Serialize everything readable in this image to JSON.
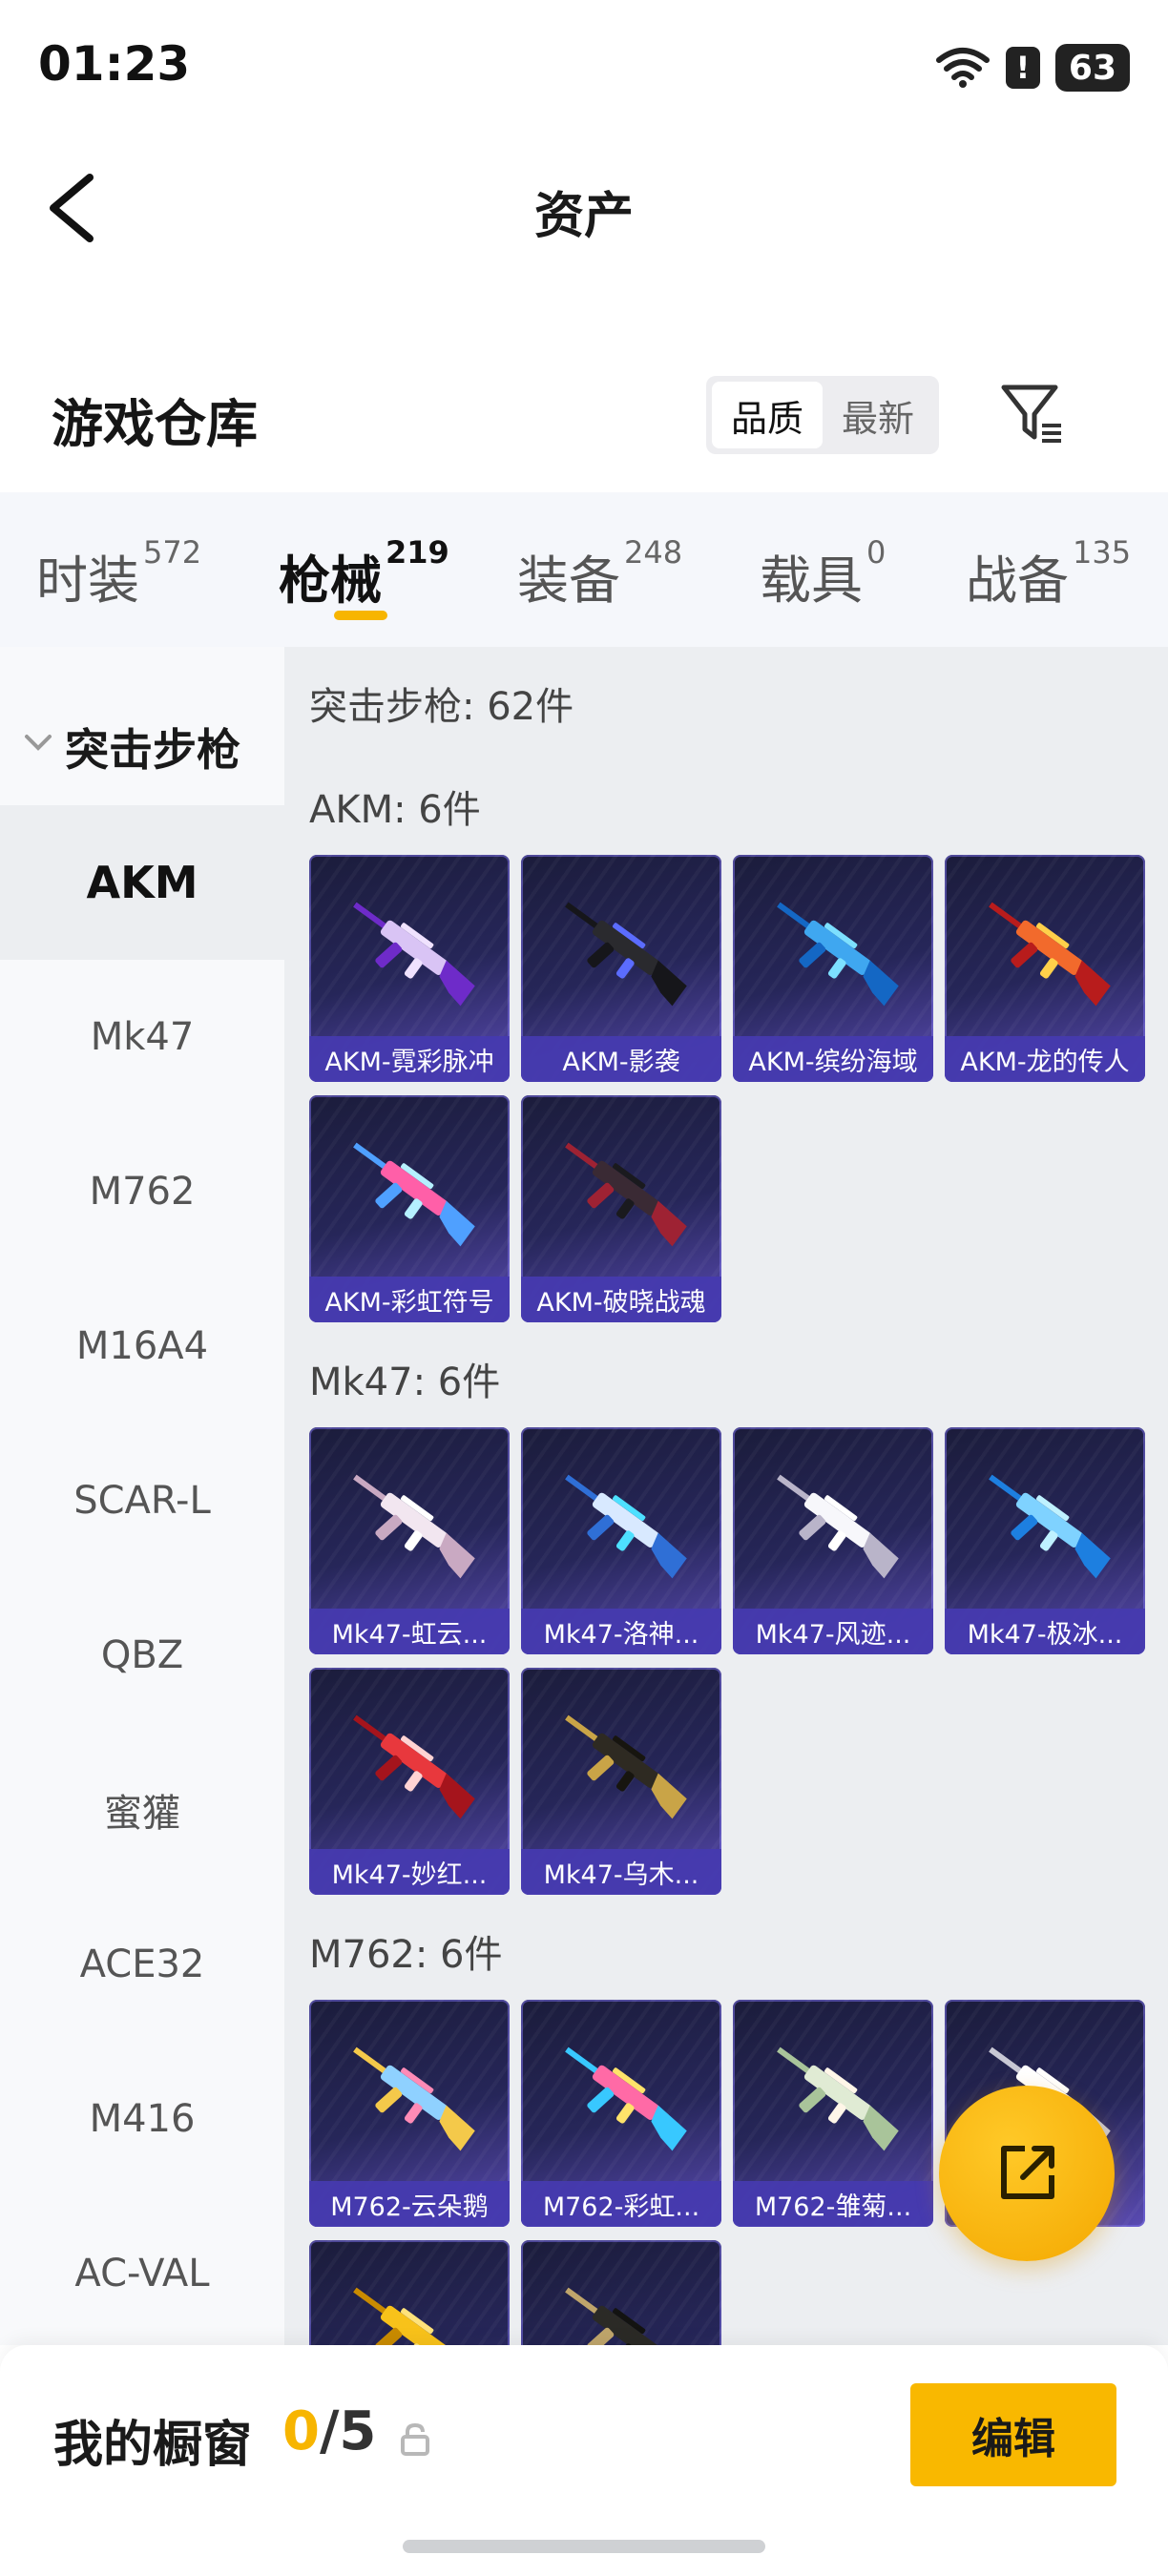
{
  "status": {
    "time": "01:23",
    "battery": "63",
    "alert": "!"
  },
  "header": {
    "title": "资产"
  },
  "warehouse": {
    "title": "游戏仓库",
    "sort_options": [
      "品质",
      "最新"
    ],
    "active_sort": "品质"
  },
  "category_tabs": [
    {
      "label": "时装",
      "count": "572"
    },
    {
      "label": "枪械",
      "count": "219"
    },
    {
      "label": "装备",
      "count": "248"
    },
    {
      "label": "载具",
      "count": "0"
    },
    {
      "label": "战备",
      "count": "135"
    }
  ],
  "active_tab": "枪械",
  "sidebar": {
    "group_label": "突击步枪",
    "items": [
      "AKM",
      "Mk47",
      "M762",
      "M16A4",
      "SCAR-L",
      "QBZ",
      "蜜獾",
      "ACE32",
      "M416",
      "AC-VAL"
    ],
    "active_item": "AKM"
  },
  "content": {
    "total": "突击步枪: 62件",
    "groups": [
      {
        "heading": "AKM: 6件",
        "items": [
          "AKM-霓彩脉冲",
          "AKM-影袭",
          "AKM-缤纷海域",
          "AKM-龙的传人",
          "AKM-彩虹符号",
          "AKM-破晓战魂"
        ]
      },
      {
        "heading": "Mk47: 6件",
        "items": [
          "Mk47-虹云...",
          "Mk47-洛神...",
          "Mk47-风迹...",
          "Mk47-极冰...",
          "Mk47-妙红...",
          "Mk47-乌木..."
        ]
      },
      {
        "heading": "M762: 6件",
        "items": [
          "M762-云朵鹅",
          "M762-彩虹...",
          "M762-雏菊...",
          "",
          "",
          ""
        ]
      }
    ]
  },
  "gun_colors": [
    [
      "#d9c4f5",
      "#6e2bc9",
      "#f0e2ff"
    ],
    [
      "#2a2a2e",
      "#16161a",
      "#5b6cff"
    ],
    [
      "#3fa7f0",
      "#1467c4",
      "#7de0ff"
    ],
    [
      "#f26a2c",
      "#b81c1c",
      "#ffd04a"
    ],
    [
      "#ff5fa8",
      "#4fa0ff",
      "#b5f0ff"
    ],
    [
      "#3a2a34",
      "#9e2233",
      "#1a1a1e"
    ],
    [
      "#f2e6f0",
      "#c9a9c2",
      "#ffffff"
    ],
    [
      "#d8e9ff",
      "#2f6fd6",
      "#4de0ff"
    ],
    [
      "#f7f7fb",
      "#b9b4c9",
      "#ffffff"
    ],
    [
      "#7fd2ff",
      "#1d7fe0",
      "#bff1ff"
    ],
    [
      "#e8383d",
      "#a5141c",
      "#ffd3d3"
    ],
    [
      "#2e2a22",
      "#c9a447",
      "#17150f"
    ],
    [
      "#8fd1ff",
      "#f4c94a",
      "#ff8bb6"
    ],
    [
      "#ff6aa6",
      "#38c8ff",
      "#ffe36a"
    ],
    [
      "#e0ebd4",
      "#a9c49a",
      "#fff6e8"
    ],
    [
      "#ffffff",
      "#c8c8d4",
      "#ffffff"
    ],
    [
      "#f8c21a",
      "#c98b00",
      "#ffe27a"
    ],
    [
      "#2b2a26",
      "#bfa56b",
      "#131311"
    ]
  ],
  "showcase": {
    "title": "我的橱窗",
    "current": "0",
    "slash": "/",
    "max": "5"
  },
  "edit_label": "编辑",
  "icons": {
    "back": "back-arrow-icon",
    "filter": "filter-icon",
    "chevron": "chevron-down-icon",
    "share": "share-external-icon",
    "lock": "lock-icon",
    "wifi": "wifi-icon"
  },
  "colors": {
    "accent": "#f7b500",
    "tile_bg": "#262659",
    "caption_bg": "#463aaf"
  }
}
